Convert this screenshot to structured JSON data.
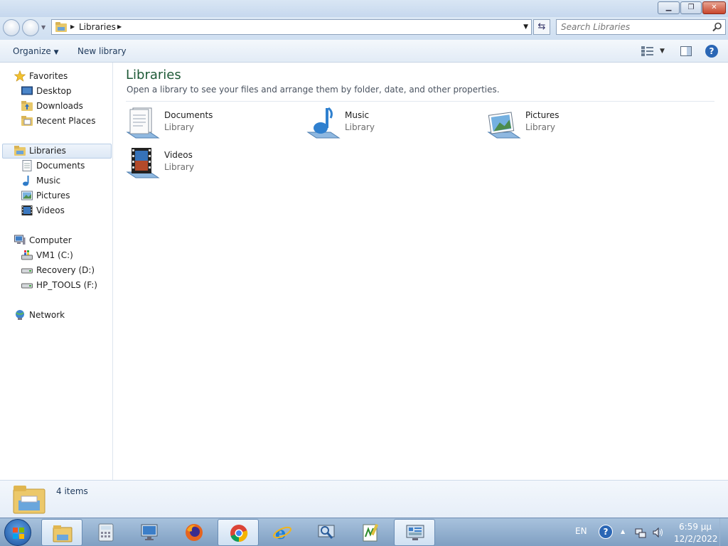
{
  "window": {
    "minimize_icon": "minimize-icon",
    "maximize_icon": "restore-icon",
    "close_icon": "close-icon"
  },
  "nav": {
    "breadcrumb": "Libraries",
    "search_placeholder": "Search Libraries"
  },
  "toolbar": {
    "organize": "Organize",
    "new_library": "New library"
  },
  "sidebar": {
    "favorites": {
      "label": "Favorites",
      "items": [
        {
          "label": "Desktop",
          "icon": "desktop-icon"
        },
        {
          "label": "Downloads",
          "icon": "downloads-icon"
        },
        {
          "label": "Recent Places",
          "icon": "recent-places-icon"
        }
      ]
    },
    "libraries": {
      "label": "Libraries",
      "items": [
        {
          "label": "Documents",
          "icon": "documents-icon"
        },
        {
          "label": "Music",
          "icon": "music-icon"
        },
        {
          "label": "Pictures",
          "icon": "pictures-icon"
        },
        {
          "label": "Videos",
          "icon": "videos-icon"
        }
      ]
    },
    "computer": {
      "label": "Computer",
      "items": [
        {
          "label": "VM1 (C:)",
          "icon": "drive-icon"
        },
        {
          "label": "Recovery (D:)",
          "icon": "drive-icon"
        },
        {
          "label": "HP_TOOLS (F:)",
          "icon": "drive-icon"
        }
      ]
    },
    "network": {
      "label": "Network"
    }
  },
  "main": {
    "title": "Libraries",
    "description": "Open a library to see your files and arrange them by folder, date, and other properties.",
    "libraries": [
      {
        "name": "Documents",
        "type": "Library"
      },
      {
        "name": "Music",
        "type": "Library"
      },
      {
        "name": "Pictures",
        "type": "Library"
      },
      {
        "name": "Videos",
        "type": "Library"
      }
    ]
  },
  "details": {
    "count": "4 items"
  },
  "taskbar": {
    "apps": [
      "windows-explorer",
      "calculator",
      "remote-desktop",
      "firefox",
      "chrome",
      "internet-explorer",
      "search-tool",
      "notepad-plus",
      "control-panel"
    ],
    "language": "EN",
    "time": "6:59 μμ",
    "date": "12/2/2022"
  },
  "colors": {
    "title_green": "#1e5a37",
    "link_blue": "#1e395b",
    "accent": "#2a66b5"
  }
}
